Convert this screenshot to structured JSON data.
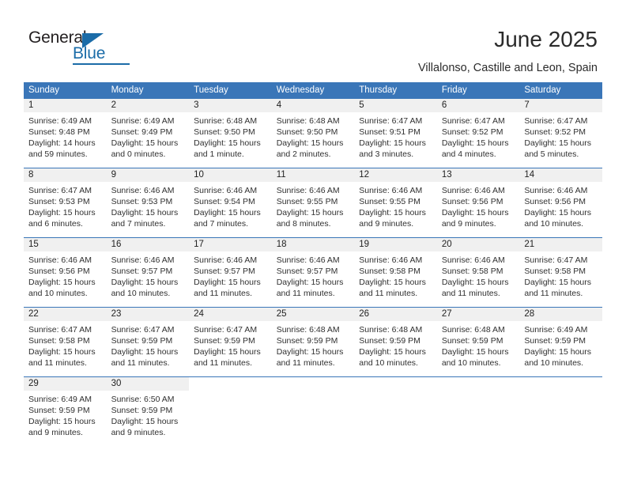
{
  "brand": {
    "name_top": "General",
    "name_bottom": "Blue",
    "accent_color": "#1b6ca8"
  },
  "header": {
    "title": "June 2025",
    "subtitle": "Villalonso, Castille and Leon, Spain"
  },
  "calendar": {
    "header_bg": "#3a76b8",
    "daynum_bg": "#f0f0f0",
    "weekdays": [
      "Sunday",
      "Monday",
      "Tuesday",
      "Wednesday",
      "Thursday",
      "Friday",
      "Saturday"
    ],
    "weeks": [
      [
        {
          "day": "1",
          "sunrise": "Sunrise: 6:49 AM",
          "sunset": "Sunset: 9:48 PM",
          "daylight": "Daylight: 14 hours and 59 minutes."
        },
        {
          "day": "2",
          "sunrise": "Sunrise: 6:49 AM",
          "sunset": "Sunset: 9:49 PM",
          "daylight": "Daylight: 15 hours and 0 minutes."
        },
        {
          "day": "3",
          "sunrise": "Sunrise: 6:48 AM",
          "sunset": "Sunset: 9:50 PM",
          "daylight": "Daylight: 15 hours and 1 minute."
        },
        {
          "day": "4",
          "sunrise": "Sunrise: 6:48 AM",
          "sunset": "Sunset: 9:50 PM",
          "daylight": "Daylight: 15 hours and 2 minutes."
        },
        {
          "day": "5",
          "sunrise": "Sunrise: 6:47 AM",
          "sunset": "Sunset: 9:51 PM",
          "daylight": "Daylight: 15 hours and 3 minutes."
        },
        {
          "day": "6",
          "sunrise": "Sunrise: 6:47 AM",
          "sunset": "Sunset: 9:52 PM",
          "daylight": "Daylight: 15 hours and 4 minutes."
        },
        {
          "day": "7",
          "sunrise": "Sunrise: 6:47 AM",
          "sunset": "Sunset: 9:52 PM",
          "daylight": "Daylight: 15 hours and 5 minutes."
        }
      ],
      [
        {
          "day": "8",
          "sunrise": "Sunrise: 6:47 AM",
          "sunset": "Sunset: 9:53 PM",
          "daylight": "Daylight: 15 hours and 6 minutes."
        },
        {
          "day": "9",
          "sunrise": "Sunrise: 6:46 AM",
          "sunset": "Sunset: 9:53 PM",
          "daylight": "Daylight: 15 hours and 7 minutes."
        },
        {
          "day": "10",
          "sunrise": "Sunrise: 6:46 AM",
          "sunset": "Sunset: 9:54 PM",
          "daylight": "Daylight: 15 hours and 7 minutes."
        },
        {
          "day": "11",
          "sunrise": "Sunrise: 6:46 AM",
          "sunset": "Sunset: 9:55 PM",
          "daylight": "Daylight: 15 hours and 8 minutes."
        },
        {
          "day": "12",
          "sunrise": "Sunrise: 6:46 AM",
          "sunset": "Sunset: 9:55 PM",
          "daylight": "Daylight: 15 hours and 9 minutes."
        },
        {
          "day": "13",
          "sunrise": "Sunrise: 6:46 AM",
          "sunset": "Sunset: 9:56 PM",
          "daylight": "Daylight: 15 hours and 9 minutes."
        },
        {
          "day": "14",
          "sunrise": "Sunrise: 6:46 AM",
          "sunset": "Sunset: 9:56 PM",
          "daylight": "Daylight: 15 hours and 10 minutes."
        }
      ],
      [
        {
          "day": "15",
          "sunrise": "Sunrise: 6:46 AM",
          "sunset": "Sunset: 9:56 PM",
          "daylight": "Daylight: 15 hours and 10 minutes."
        },
        {
          "day": "16",
          "sunrise": "Sunrise: 6:46 AM",
          "sunset": "Sunset: 9:57 PM",
          "daylight": "Daylight: 15 hours and 10 minutes."
        },
        {
          "day": "17",
          "sunrise": "Sunrise: 6:46 AM",
          "sunset": "Sunset: 9:57 PM",
          "daylight": "Daylight: 15 hours and 11 minutes."
        },
        {
          "day": "18",
          "sunrise": "Sunrise: 6:46 AM",
          "sunset": "Sunset: 9:57 PM",
          "daylight": "Daylight: 15 hours and 11 minutes."
        },
        {
          "day": "19",
          "sunrise": "Sunrise: 6:46 AM",
          "sunset": "Sunset: 9:58 PM",
          "daylight": "Daylight: 15 hours and 11 minutes."
        },
        {
          "day": "20",
          "sunrise": "Sunrise: 6:46 AM",
          "sunset": "Sunset: 9:58 PM",
          "daylight": "Daylight: 15 hours and 11 minutes."
        },
        {
          "day": "21",
          "sunrise": "Sunrise: 6:47 AM",
          "sunset": "Sunset: 9:58 PM",
          "daylight": "Daylight: 15 hours and 11 minutes."
        }
      ],
      [
        {
          "day": "22",
          "sunrise": "Sunrise: 6:47 AM",
          "sunset": "Sunset: 9:58 PM",
          "daylight": "Daylight: 15 hours and 11 minutes."
        },
        {
          "day": "23",
          "sunrise": "Sunrise: 6:47 AM",
          "sunset": "Sunset: 9:59 PM",
          "daylight": "Daylight: 15 hours and 11 minutes."
        },
        {
          "day": "24",
          "sunrise": "Sunrise: 6:47 AM",
          "sunset": "Sunset: 9:59 PM",
          "daylight": "Daylight: 15 hours and 11 minutes."
        },
        {
          "day": "25",
          "sunrise": "Sunrise: 6:48 AM",
          "sunset": "Sunset: 9:59 PM",
          "daylight": "Daylight: 15 hours and 11 minutes."
        },
        {
          "day": "26",
          "sunrise": "Sunrise: 6:48 AM",
          "sunset": "Sunset: 9:59 PM",
          "daylight": "Daylight: 15 hours and 10 minutes."
        },
        {
          "day": "27",
          "sunrise": "Sunrise: 6:48 AM",
          "sunset": "Sunset: 9:59 PM",
          "daylight": "Daylight: 15 hours and 10 minutes."
        },
        {
          "day": "28",
          "sunrise": "Sunrise: 6:49 AM",
          "sunset": "Sunset: 9:59 PM",
          "daylight": "Daylight: 15 hours and 10 minutes."
        }
      ],
      [
        {
          "day": "29",
          "sunrise": "Sunrise: 6:49 AM",
          "sunset": "Sunset: 9:59 PM",
          "daylight": "Daylight: 15 hours and 9 minutes."
        },
        {
          "day": "30",
          "sunrise": "Sunrise: 6:50 AM",
          "sunset": "Sunset: 9:59 PM",
          "daylight": "Daylight: 15 hours and 9 minutes."
        },
        {
          "day": "",
          "sunrise": "",
          "sunset": "",
          "daylight": ""
        },
        {
          "day": "",
          "sunrise": "",
          "sunset": "",
          "daylight": ""
        },
        {
          "day": "",
          "sunrise": "",
          "sunset": "",
          "daylight": ""
        },
        {
          "day": "",
          "sunrise": "",
          "sunset": "",
          "daylight": ""
        },
        {
          "day": "",
          "sunrise": "",
          "sunset": "",
          "daylight": ""
        }
      ]
    ]
  }
}
